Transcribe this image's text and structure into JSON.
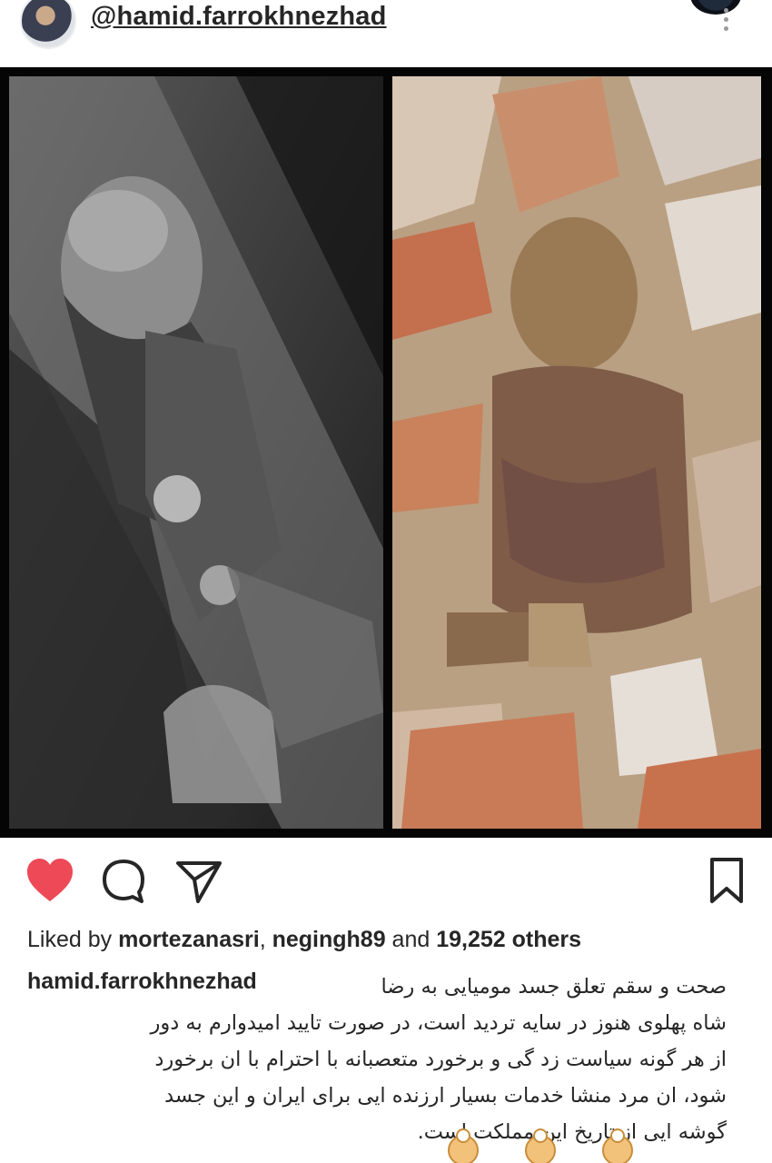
{
  "header": {
    "username": "@hamid.farrokhnezhad",
    "avatar_icon": "profile-avatar",
    "more_icon": "vertical-dots-icon"
  },
  "post": {
    "left_photo": "black-and-white photo of a man in uniform lying in state",
    "right_photo": "color photo of a mummified body among broken bricks"
  },
  "actions": {
    "like_icon": "heart-filled-icon",
    "comment_icon": "comment-bubble-icon",
    "share_icon": "send-paper-plane-icon",
    "save_icon": "bookmark-icon",
    "like_color": "#ed4956"
  },
  "likes": {
    "prefix": "Liked by ",
    "user1": "mortezanasri",
    "sep": ", ",
    "user2": "negingh89",
    "mid": " and ",
    "count": "19,252 others"
  },
  "caption": {
    "username": "hamid.farrokhnezhad",
    "line1": "صحت و سقم تعلق جسد مومیایی به رضا",
    "line2": "شاه پهلوی هنوز در سایه تردید است، در صورت تایید امیدوارم به دور",
    "line3": "از هر گونه سیاست زد گی و برخورد متعصبانه با احترام با ان برخورد",
    "line4": "شود، ان مرد منشا خدمات بسیار ارزنده ایی برای ایران و این جسد",
    "line5": "گوشه ایی از تاریخ این مملکت است.",
    "emoji": "ok-hand-emoji"
  }
}
